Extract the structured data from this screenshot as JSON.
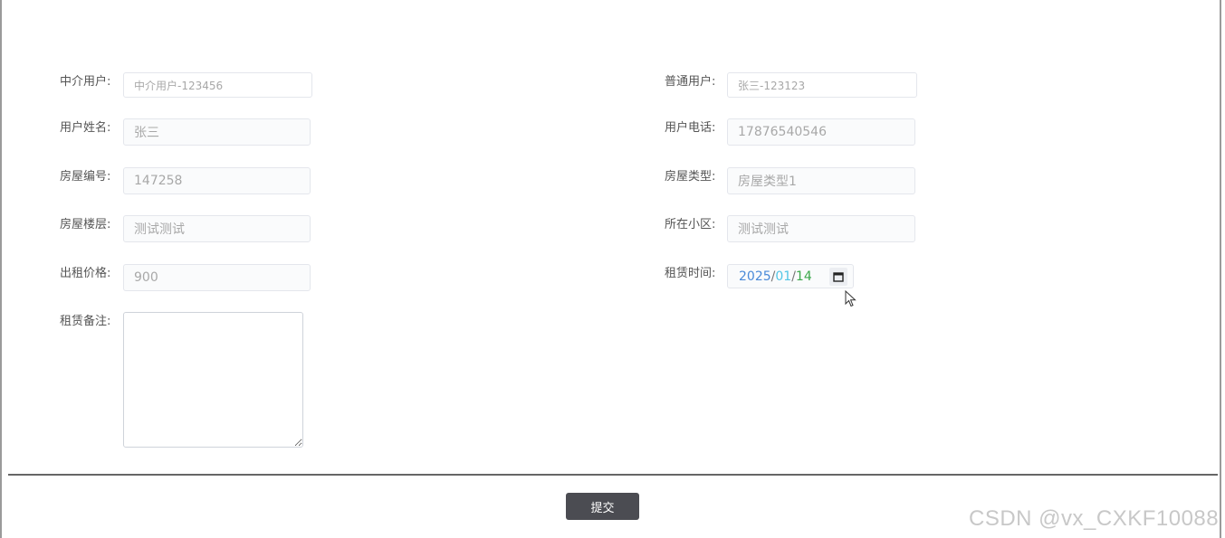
{
  "form": {
    "agent_user": {
      "label": "中介用户:",
      "value": "中介用户-123456"
    },
    "normal_user": {
      "label": "普通用户:",
      "value": "张三-123123"
    },
    "user_name": {
      "label": "用户姓名:",
      "value": "张三"
    },
    "user_phone": {
      "label": "用户电话:",
      "value": "17876540546"
    },
    "house_no": {
      "label": "房屋编号:",
      "value": "147258"
    },
    "house_type": {
      "label": "房屋类型:",
      "value": "房屋类型1"
    },
    "house_floor": {
      "label": "房屋楼层:",
      "value": "测试测试"
    },
    "community": {
      "label": "所在小区:",
      "value": "测试测试"
    },
    "rent_price": {
      "label": "出租价格:",
      "value": "900"
    },
    "rent_time": {
      "label": "租赁时间:",
      "year": "2025",
      "month": "01",
      "day": "14",
      "sep": "/"
    },
    "rent_remark": {
      "label": "租赁备注:",
      "value": ""
    }
  },
  "submit_label": "提交",
  "watermark": "CSDN @vx_CXKF10088",
  "icons": {
    "calendar": "calendar-icon",
    "cursor": "mouse-cursor-icon"
  },
  "colors": {
    "submit_bg": "#4b4c52",
    "year": "#4a8ad8",
    "month": "#52c6e6",
    "day": "#3aa84a"
  }
}
